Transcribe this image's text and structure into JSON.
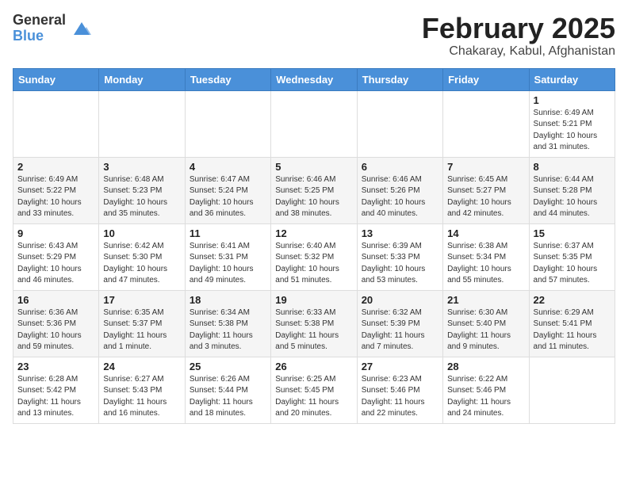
{
  "header": {
    "logo_general": "General",
    "logo_blue": "Blue",
    "month": "February 2025",
    "location": "Chakaray, Kabul, Afghanistan"
  },
  "weekdays": [
    "Sunday",
    "Monday",
    "Tuesday",
    "Wednesday",
    "Thursday",
    "Friday",
    "Saturday"
  ],
  "weeks": [
    [
      {
        "day": "",
        "info": ""
      },
      {
        "day": "",
        "info": ""
      },
      {
        "day": "",
        "info": ""
      },
      {
        "day": "",
        "info": ""
      },
      {
        "day": "",
        "info": ""
      },
      {
        "day": "",
        "info": ""
      },
      {
        "day": "1",
        "info": "Sunrise: 6:49 AM\nSunset: 5:21 PM\nDaylight: 10 hours\nand 31 minutes."
      }
    ],
    [
      {
        "day": "2",
        "info": "Sunrise: 6:49 AM\nSunset: 5:22 PM\nDaylight: 10 hours\nand 33 minutes."
      },
      {
        "day": "3",
        "info": "Sunrise: 6:48 AM\nSunset: 5:23 PM\nDaylight: 10 hours\nand 35 minutes."
      },
      {
        "day": "4",
        "info": "Sunrise: 6:47 AM\nSunset: 5:24 PM\nDaylight: 10 hours\nand 36 minutes."
      },
      {
        "day": "5",
        "info": "Sunrise: 6:46 AM\nSunset: 5:25 PM\nDaylight: 10 hours\nand 38 minutes."
      },
      {
        "day": "6",
        "info": "Sunrise: 6:46 AM\nSunset: 5:26 PM\nDaylight: 10 hours\nand 40 minutes."
      },
      {
        "day": "7",
        "info": "Sunrise: 6:45 AM\nSunset: 5:27 PM\nDaylight: 10 hours\nand 42 minutes."
      },
      {
        "day": "8",
        "info": "Sunrise: 6:44 AM\nSunset: 5:28 PM\nDaylight: 10 hours\nand 44 minutes."
      }
    ],
    [
      {
        "day": "9",
        "info": "Sunrise: 6:43 AM\nSunset: 5:29 PM\nDaylight: 10 hours\nand 46 minutes."
      },
      {
        "day": "10",
        "info": "Sunrise: 6:42 AM\nSunset: 5:30 PM\nDaylight: 10 hours\nand 47 minutes."
      },
      {
        "day": "11",
        "info": "Sunrise: 6:41 AM\nSunset: 5:31 PM\nDaylight: 10 hours\nand 49 minutes."
      },
      {
        "day": "12",
        "info": "Sunrise: 6:40 AM\nSunset: 5:32 PM\nDaylight: 10 hours\nand 51 minutes."
      },
      {
        "day": "13",
        "info": "Sunrise: 6:39 AM\nSunset: 5:33 PM\nDaylight: 10 hours\nand 53 minutes."
      },
      {
        "day": "14",
        "info": "Sunrise: 6:38 AM\nSunset: 5:34 PM\nDaylight: 10 hours\nand 55 minutes."
      },
      {
        "day": "15",
        "info": "Sunrise: 6:37 AM\nSunset: 5:35 PM\nDaylight: 10 hours\nand 57 minutes."
      }
    ],
    [
      {
        "day": "16",
        "info": "Sunrise: 6:36 AM\nSunset: 5:36 PM\nDaylight: 10 hours\nand 59 minutes."
      },
      {
        "day": "17",
        "info": "Sunrise: 6:35 AM\nSunset: 5:37 PM\nDaylight: 11 hours\nand 1 minute."
      },
      {
        "day": "18",
        "info": "Sunrise: 6:34 AM\nSunset: 5:38 PM\nDaylight: 11 hours\nand 3 minutes."
      },
      {
        "day": "19",
        "info": "Sunrise: 6:33 AM\nSunset: 5:38 PM\nDaylight: 11 hours\nand 5 minutes."
      },
      {
        "day": "20",
        "info": "Sunrise: 6:32 AM\nSunset: 5:39 PM\nDaylight: 11 hours\nand 7 minutes."
      },
      {
        "day": "21",
        "info": "Sunrise: 6:30 AM\nSunset: 5:40 PM\nDaylight: 11 hours\nand 9 minutes."
      },
      {
        "day": "22",
        "info": "Sunrise: 6:29 AM\nSunset: 5:41 PM\nDaylight: 11 hours\nand 11 minutes."
      }
    ],
    [
      {
        "day": "23",
        "info": "Sunrise: 6:28 AM\nSunset: 5:42 PM\nDaylight: 11 hours\nand 13 minutes."
      },
      {
        "day": "24",
        "info": "Sunrise: 6:27 AM\nSunset: 5:43 PM\nDaylight: 11 hours\nand 16 minutes."
      },
      {
        "day": "25",
        "info": "Sunrise: 6:26 AM\nSunset: 5:44 PM\nDaylight: 11 hours\nand 18 minutes."
      },
      {
        "day": "26",
        "info": "Sunrise: 6:25 AM\nSunset: 5:45 PM\nDaylight: 11 hours\nand 20 minutes."
      },
      {
        "day": "27",
        "info": "Sunrise: 6:23 AM\nSunset: 5:46 PM\nDaylight: 11 hours\nand 22 minutes."
      },
      {
        "day": "28",
        "info": "Sunrise: 6:22 AM\nSunset: 5:46 PM\nDaylight: 11 hours\nand 24 minutes."
      },
      {
        "day": "",
        "info": ""
      }
    ]
  ]
}
